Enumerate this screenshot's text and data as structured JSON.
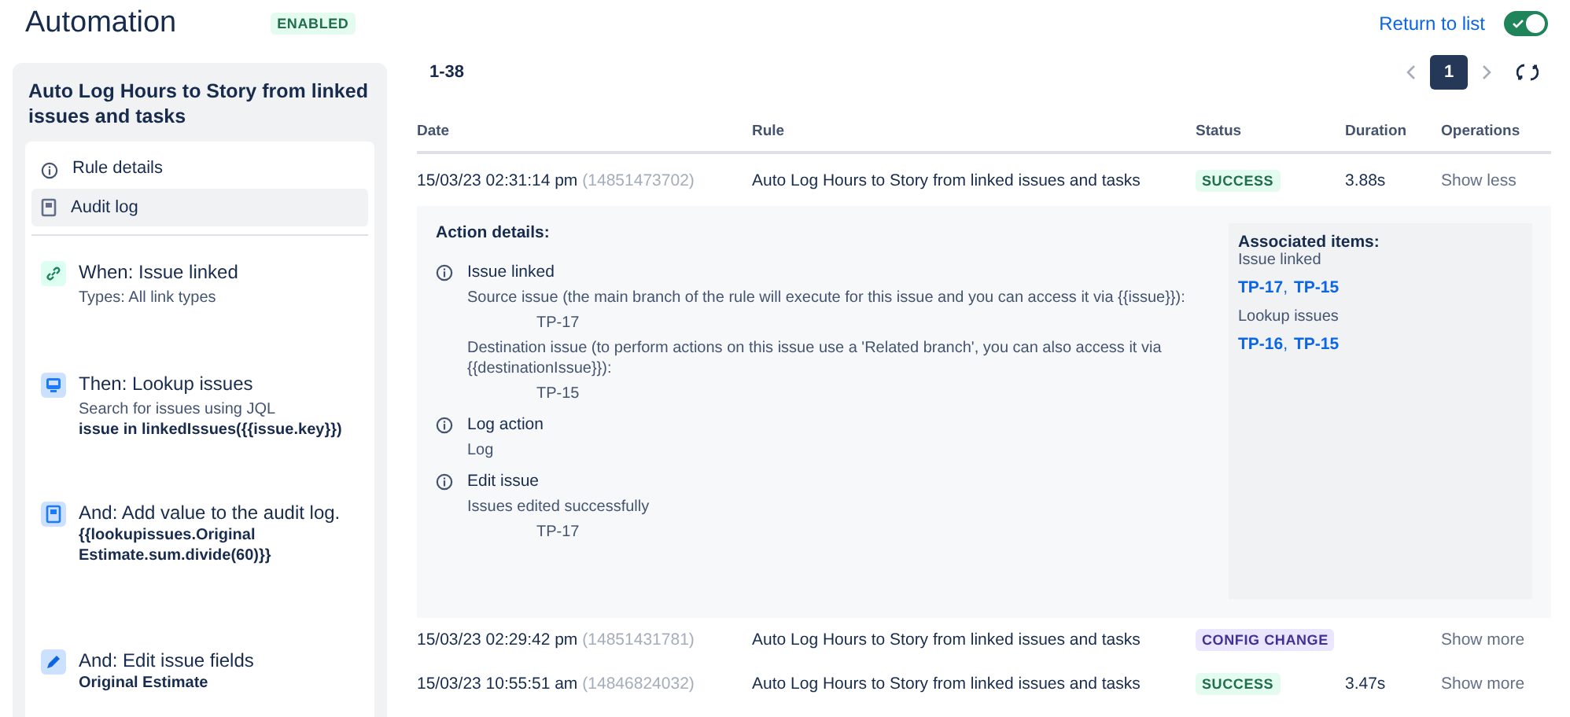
{
  "header": {
    "title": "Automation",
    "status_badge": "ENABLED",
    "return_link": "Return to list",
    "toggle": {
      "on": true
    }
  },
  "sidebar": {
    "rule_title": "Auto Log Hours to Story from linked issues and tasks",
    "menu": [
      {
        "label": "Rule details",
        "kind": "info",
        "selected": false
      },
      {
        "label": "Audit log",
        "kind": "log",
        "selected": true
      }
    ],
    "steps": [
      {
        "kind": "link",
        "title": "When: Issue linked",
        "description": "Types: All link types"
      },
      {
        "kind": "lookup",
        "title": "Then: Lookup issues",
        "description": "Search for issues using JQL",
        "code": "issue in linkedIssues({{issue.key}})"
      },
      {
        "kind": "audit",
        "title": "And: Add value to the audit log.",
        "code": "{{lookupissues.Original Estimate.sum.divide(60)}}"
      },
      {
        "kind": "edit",
        "title": "And: Edit issue fields",
        "code": "Original Estimate"
      }
    ]
  },
  "log": {
    "range": "1-38",
    "pagination": {
      "pages": [
        {
          "label": "1",
          "selected": true
        }
      ]
    },
    "columns": [
      "Date",
      "Rule",
      "Status",
      "Duration",
      "Operations"
    ],
    "rows": [
      {
        "date": "15/03/23 02:31:14 pm",
        "id": "(14851473702)",
        "rule": "Auto Log Hours to Story from linked issues and tasks",
        "status": {
          "label": "SUCCESS",
          "kind": "success"
        },
        "duration": "3.88s",
        "operation": "Show less",
        "expanded": true,
        "details": {
          "heading": "Action details:",
          "actions": [
            {
              "title": "Issue linked",
              "lines": [
                {
                  "kind": "text",
                  "text": "Source issue (the main branch of the rule will execute for this issue and you can access it via {{issue}}):"
                },
                {
                  "kind": "issue",
                  "text": "TP-17"
                },
                {
                  "kind": "text",
                  "text": "Destination issue (to perform actions on this issue use a 'Related branch', you can also access it via {{destinationIssue}}):"
                },
                {
                  "kind": "issue",
                  "text": "TP-15"
                }
              ]
            },
            {
              "title": "Log action",
              "lines": [
                {
                  "kind": "text",
                  "text": "Log"
                }
              ]
            },
            {
              "title": "Edit issue",
              "lines": [
                {
                  "kind": "text",
                  "text": "Issues edited successfully"
                },
                {
                  "kind": "issue",
                  "text": "TP-17"
                }
              ]
            }
          ],
          "associated": {
            "heading": "Associated items:",
            "groups": [
              {
                "label": "Issue linked",
                "separator": ",",
                "issues": [
                  "TP-17",
                  "TP-15"
                ]
              },
              {
                "label": "Lookup issues",
                "separator": ",",
                "issues": [
                  "TP-16",
                  "TP-15"
                ]
              }
            ]
          }
        }
      },
      {
        "date": "15/03/23 02:29:42 pm",
        "id": "(14851431781)",
        "rule": "Auto Log Hours to Story from linked issues and tasks",
        "status": {
          "label": "CONFIG CHANGE",
          "kind": "config"
        },
        "operation": "Show more"
      },
      {
        "date": "15/03/23 10:55:51 am",
        "id": "(14846824032)",
        "rule": "Auto Log Hours to Story from linked issues and tasks",
        "status": {
          "label": "SUCCESS",
          "kind": "success"
        },
        "duration": "3.47s",
        "operation": "Show more"
      }
    ]
  }
}
